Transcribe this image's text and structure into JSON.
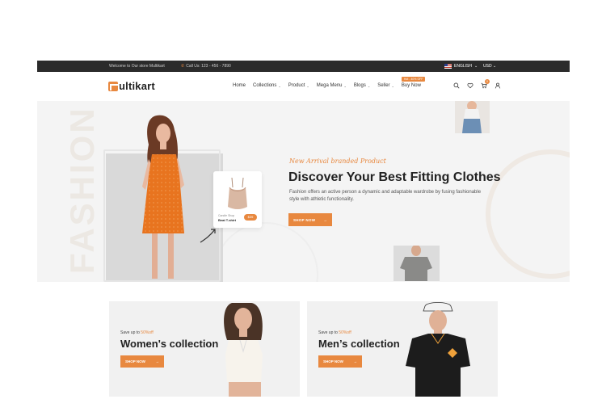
{
  "topbar": {
    "welcome": "Welcome to Our store Multikart",
    "call": "Call Us: 123 - 456 - 7890",
    "language": "ENGLISH",
    "currency": "USD"
  },
  "header": {
    "logo_text": "ultikart",
    "nav": [
      {
        "label": "Home",
        "dropdown": false
      },
      {
        "label": "Collections",
        "dropdown": true
      },
      {
        "label": "Product",
        "dropdown": true
      },
      {
        "label": "Mega Menu",
        "dropdown": true
      },
      {
        "label": "Blogs",
        "dropdown": true
      },
      {
        "label": "Seller",
        "dropdown": true
      }
    ],
    "buy_now": "Buy Now",
    "buy_now_tag": "Hot - 40% OFF",
    "cart_count": "0",
    "icons": [
      "search-icon",
      "heart-icon",
      "cart-icon",
      "user-icon"
    ]
  },
  "hero": {
    "bg_word": "FASHION",
    "eyebrow": "New Arrival branded Product",
    "headline": "Discover Your Best Fitting Clothes",
    "description": "Fashion offers an active person a dynamic and adaptable wardrobe by fusing fashionable style with athletic functionality.",
    "button": "SHOP NOW",
    "product_card": {
      "shop": "Candle Shop",
      "name": "Beat T-shirt",
      "price": "$39"
    }
  },
  "collections": [
    {
      "save_prefix": "Save up to ",
      "save_pct": "50%off",
      "title": "Women's collection",
      "button": "SHOP NOW"
    },
    {
      "save_prefix": "Save up to ",
      "save_pct": "50%off",
      "title": "Men’s collection",
      "button": "SHOP NOW"
    }
  ],
  "colors": {
    "accent": "#e8883f",
    "topbar": "#2b2b2b",
    "hero_bg": "#f4f4f4"
  }
}
